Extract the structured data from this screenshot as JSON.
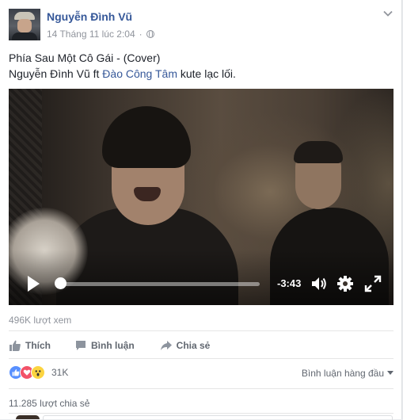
{
  "post": {
    "author": "Nguyễn Đình Vũ",
    "timestamp": "14 Tháng 11 lúc 2:04",
    "separator": "·",
    "line1": "Phía Sau Một Cô Gái - (Cover)",
    "line2_prefix": "Nguyễn Đình Vũ ft ",
    "line2_link": "Đào Công Tâm",
    "line2_suffix": " kute lạc lối."
  },
  "video": {
    "time_remaining": "-3:43",
    "progress": 0.02,
    "icons": [
      "play-icon",
      "volume-icon",
      "settings-gear-icon",
      "fullscreen-icon"
    ]
  },
  "stats": {
    "views": "496K lượt xem",
    "reactions_count": "31K",
    "shares": "11.285 lượt chia sẻ"
  },
  "actions": {
    "like": "Thích",
    "comment": "Bình luận",
    "share": "Chia sẻ"
  },
  "comments": {
    "sort_label": "Bình luận hàng đầu"
  },
  "colors": {
    "link": "#365899",
    "like_blue": "#5890ff",
    "love_red": "#f25268",
    "wow_yellow": "#fcd440"
  }
}
